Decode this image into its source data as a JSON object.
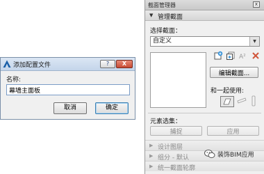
{
  "dialog": {
    "title": "添加配置文件",
    "help_label": "?",
    "close_label": "X",
    "name_label": "名称:",
    "name_value": "幕墙主面板",
    "cancel_label": "取消",
    "ok_label": "确定"
  },
  "palette": {
    "title": "截面管理器",
    "close_label": "x",
    "section_title": "管理截面",
    "select_label": "选择截面：",
    "select_value": "自定义",
    "edit_button_label": "编辑截面...",
    "use_with_label": "和一起使用:",
    "element_filter_label": "元素选集：",
    "capture_label": "捕捉",
    "apply_label": "应用",
    "collapsed_rows": [
      "设计图层",
      "组分 - 默认",
      "统一截面轮廓"
    ],
    "rename_icon_text": "A²"
  },
  "watermark": {
    "text": "装饰BIM应用"
  },
  "colors": {
    "accent_blue": "#1a5fa8",
    "delete_red": "#d0553a"
  }
}
